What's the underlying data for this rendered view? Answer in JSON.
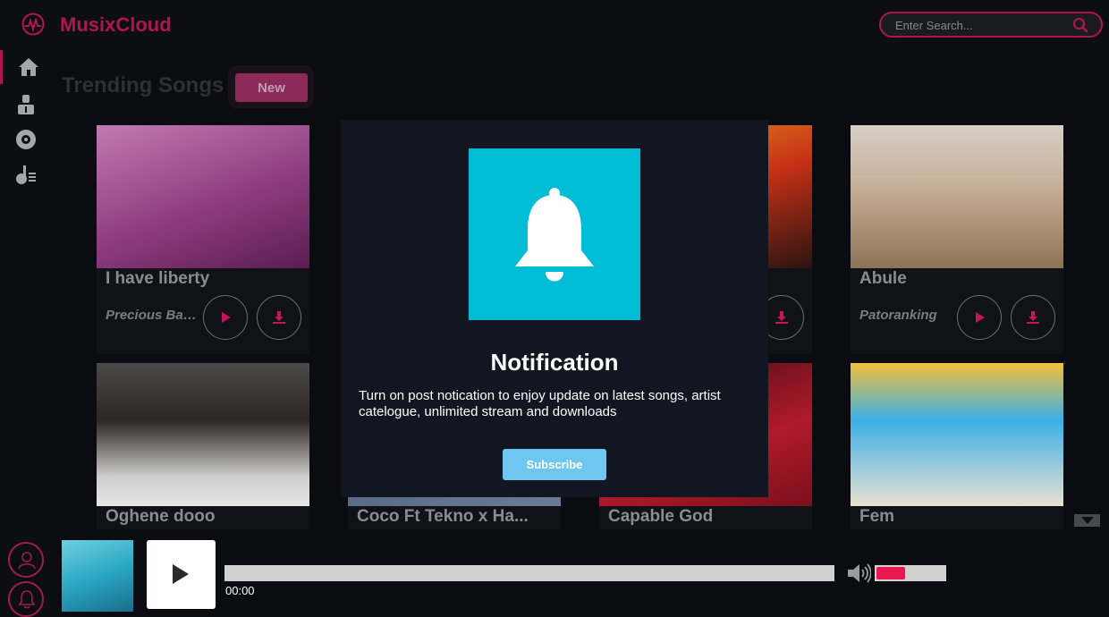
{
  "app": {
    "title": "MusixCloud",
    "brand_color": "#b0164d"
  },
  "search": {
    "placeholder": "Enter Search..."
  },
  "sidebar": {
    "items": [
      {
        "name": "home",
        "icon": "home-icon",
        "active": true
      },
      {
        "name": "artists",
        "icon": "artist-icon",
        "active": false
      },
      {
        "name": "albums",
        "icon": "disc-icon",
        "active": false
      },
      {
        "name": "playlists",
        "icon": "playlist-icon",
        "active": false
      }
    ],
    "bottom": [
      {
        "icon": "user-icon"
      },
      {
        "icon": "bell-icon"
      }
    ]
  },
  "main": {
    "section_title": "Trending Songs",
    "new_label": "New"
  },
  "songs": [
    {
      "title": "I have liberty",
      "artist": "Precious Balogun",
      "cover_colors": [
        "#b36fa5",
        "#7c2a6e"
      ]
    },
    {
      "title": "",
      "artist": "",
      "cover_colors": [
        "#2a4a66",
        "#6a8aa8"
      ]
    },
    {
      "title": "",
      "artist": "",
      "cover_colors": [
        "#c63016",
        "#e89a1a"
      ]
    },
    {
      "title": "Abule",
      "artist": "Patoranking",
      "cover_colors": [
        "#d9cfc4",
        "#a0866a"
      ]
    },
    {
      "title": "Oghene dooo",
      "artist": "",
      "cover_colors": [
        "#c8c8c8",
        "#5a4a40"
      ]
    },
    {
      "title": "Coco Ft Tekno x Ha...",
      "artist": "",
      "cover_colors": [
        "#3a4d6a",
        "#6b7d96"
      ]
    },
    {
      "title": "Capable God",
      "artist": "",
      "cover_colors": [
        "#b01a2a",
        "#3a0a12"
      ]
    },
    {
      "title": "Fem",
      "artist": "",
      "cover_colors": [
        "#3bb0e6",
        "#f3c03a"
      ]
    }
  ],
  "modal": {
    "title": "Notification",
    "text": "Turn on post notication to enjoy update on latest songs, artist catelogue, unlimited stream and downloads",
    "subscribe_label": "Subscribe",
    "accent": "#00bcd4"
  },
  "player": {
    "time": "00:00",
    "progress": 0,
    "volume": 0.42,
    "volume_color": "#e8194f"
  }
}
